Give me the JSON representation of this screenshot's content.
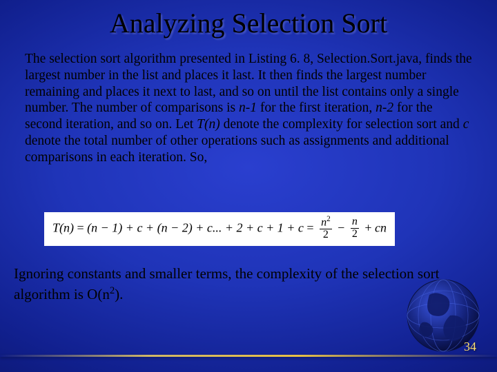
{
  "title": "Analyzing Selection Sort",
  "para1_pre": "The selection sort algorithm presented in Listing 6. 8, Selection.Sort.java, finds the largest number in the list and places it last. It then finds the largest number remaining and places it next to last, and so on until the list contains only a single number. The number of comparisons is ",
  "n_minus_1": "n-1",
  "para1_mid1": " for the first iteration, ",
  "n_minus_2": "n-2",
  "para1_mid2": " for the second iteration, and so on. Let ",
  "T_of_n": "T(n)",
  "para1_mid3": " denote the complexity for selection sort and ",
  "c_var": "c",
  "para1_end": " denote the total number of other operations such as assignments and additional comparisons in each iteration. So,",
  "formula": {
    "lhs": "T(n)",
    "eq": " = ",
    "rhs_sum": "(n − 1) + c + (n − 2) + c... + 2 + c + 1 + c",
    "num1": "n",
    "num1_sup": "2",
    "den1": "2",
    "minus": " − ",
    "num2": "n",
    "den2": "2",
    "plus": " + ",
    "tail": "cn"
  },
  "para2_pre": "Ignoring constants and smaller terms, the complexity of the selection sort algorithm is O(n",
  "para2_sup": "2",
  "para2_post": ").",
  "page_number": "34"
}
